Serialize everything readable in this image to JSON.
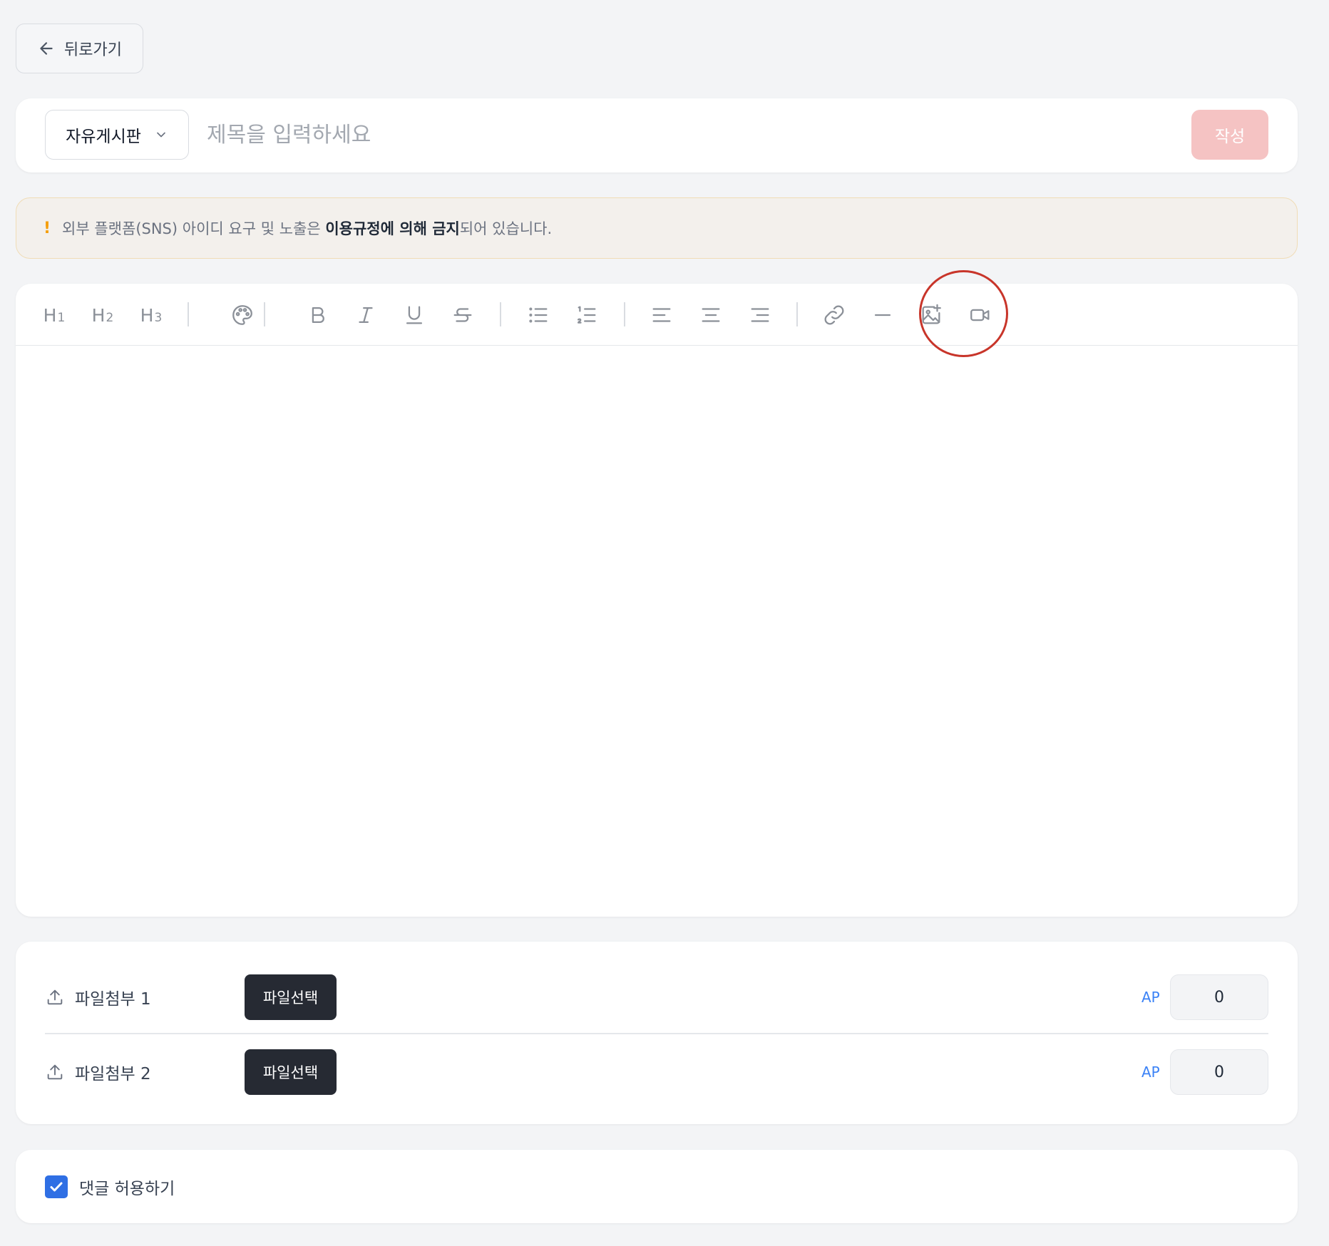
{
  "back": {
    "label": "뒤로가기"
  },
  "compose": {
    "board_select": "자유게시판",
    "title_placeholder": "제목을 입력하세요",
    "submit_label": "작성"
  },
  "notice": {
    "mark": "!",
    "text_before": "외부 플랫폼(SNS) 아이디 요구 및 노출은 ",
    "text_bold": "이용규정에 의해 금지",
    "text_after": "되어 있습니다."
  },
  "toolbar": {
    "headings": [
      {
        "main": "H",
        "sub": "1"
      },
      {
        "main": "H",
        "sub": "2"
      },
      {
        "main": "H",
        "sub": "3"
      }
    ],
    "icons": [
      "palette-icon",
      "bold-icon",
      "italic-icon",
      "underline-icon",
      "strikethrough-icon",
      "bullet-list-icon",
      "ordered-list-icon",
      "align-left-icon",
      "align-center-icon",
      "align-right-icon",
      "link-icon",
      "horizontal-rule-icon",
      "image-icon",
      "video-icon"
    ],
    "highlight_color": "#c8352a"
  },
  "attachments": [
    {
      "label": "파일첨부 1",
      "button": "파일선택",
      "ap_label": "AP",
      "ap_value": "0"
    },
    {
      "label": "파일첨부 2",
      "button": "파일선택",
      "ap_label": "AP",
      "ap_value": "0"
    }
  ],
  "comments": {
    "label": "댓글 허용하기",
    "checked": true
  },
  "colors": {
    "accent": "#2f6fe4",
    "submit_disabled": "#f5c3c3",
    "notice_bg": "#f3f0ec",
    "ap_text": "#3b82f6"
  }
}
